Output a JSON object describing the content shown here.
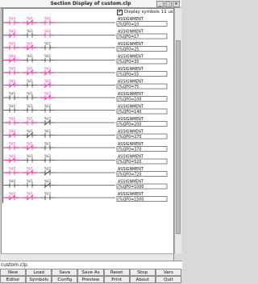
{
  "window": {
    "title": "Section Display of custom.clp"
  },
  "display_symbols": {
    "label": "Display symbols",
    "checked": true,
    "time": "11 us"
  },
  "rungs": [
    {
      "contacts": [
        "%I0",
        "%I1",
        "%I2"
      ],
      "active": [
        true,
        true,
        true
      ],
      "negated": [
        false,
        true,
        false
      ],
      "coil_label": "ASSIGNMENT",
      "coil_value": "(%QF0=10"
    },
    {
      "contacts": [
        "%I0",
        "%I1",
        "%I2"
      ],
      "active": [
        true,
        false,
        true
      ],
      "negated": [
        true,
        false,
        false
      ],
      "coil_label": "ASSIGNMENT",
      "coil_value": "(%QF0=17"
    },
    {
      "contacts": [
        "%I0",
        "%I1",
        "%I2"
      ],
      "active": [
        true,
        true,
        false
      ],
      "negated": [
        false,
        true,
        false
      ],
      "coil_label": "ASSIGNMENT",
      "coil_value": "(%QF0=25"
    },
    {
      "contacts": [
        "%I0",
        "%I1",
        "%I2"
      ],
      "active": [
        true,
        false,
        false
      ],
      "negated": [
        true,
        false,
        false
      ],
      "coil_label": "ASSIGNMENT",
      "coil_value": "(%QF0=35"
    },
    {
      "contacts": [
        "%I0",
        "%I1",
        "%I2"
      ],
      "active": [
        true,
        true,
        true
      ],
      "negated": [
        false,
        true,
        true
      ],
      "coil_label": "ASSIGNMENT",
      "coil_value": "(%QF0=55"
    },
    {
      "contacts": [
        "%I0",
        "%I1",
        "%I2"
      ],
      "active": [
        true,
        false,
        true
      ],
      "negated": [
        true,
        false,
        true
      ],
      "coil_label": "ASSIGNMENT",
      "coil_value": "(%QF0=75"
    },
    {
      "contacts": [
        "%I0",
        "%I1",
        "%I2"
      ],
      "active": [
        false,
        false,
        true
      ],
      "negated": [
        false,
        false,
        true
      ],
      "coil_label": "ASSIGNMENT",
      "coil_value": "(%QF0=100"
    },
    {
      "contacts": [
        "%I0",
        "%I1",
        "%I2"
      ],
      "active": [
        false,
        false,
        false
      ],
      "negated": [
        false,
        false,
        false
      ],
      "coil_label": "ASSIGNMENT",
      "coil_value": "(%QF0=140"
    },
    {
      "contacts": [
        "%I0",
        "%I1",
        "%I2"
      ],
      "active": [
        true,
        true,
        false
      ],
      "negated": [
        false,
        false,
        true
      ],
      "coil_label": "ASSIGNMENT",
      "coil_value": "(%QF0=200"
    },
    {
      "contacts": [
        "%I0",
        "%I1",
        "%I2"
      ],
      "active": [
        true,
        false,
        false
      ],
      "negated": [
        true,
        true,
        false
      ],
      "coil_label": "ASSIGNMENT",
      "coil_value": "(%QF0=270"
    },
    {
      "contacts": [
        "%I0",
        "%I1",
        "%I2"
      ],
      "active": [
        true,
        true,
        false
      ],
      "negated": [
        false,
        true,
        false
      ],
      "coil_label": "ASSIGNMENT",
      "coil_value": "(%QF0=370"
    },
    {
      "contacts": [
        "%I0",
        "%I1",
        "%I2"
      ],
      "active": [
        true,
        false,
        false
      ],
      "negated": [
        true,
        false,
        false
      ],
      "coil_label": "ASSIGNMENT",
      "coil_value": "(%QF0=520"
    },
    {
      "contacts": [
        "%I0",
        "%I1",
        "%I2"
      ],
      "active": [
        true,
        true,
        false
      ],
      "negated": [
        false,
        true,
        true
      ],
      "coil_label": "ASSIGNMENT",
      "coil_value": "(%QF0=720"
    },
    {
      "contacts": [
        "%I0",
        "%I1",
        "%I2"
      ],
      "active": [
        false,
        false,
        false
      ],
      "negated": [
        false,
        false,
        true
      ],
      "coil_label": "ASSIGNMENT",
      "coil_value": "(%QF0=1000"
    },
    {
      "contacts": [
        "%I0",
        "%I1",
        "%I2"
      ],
      "active": [
        true,
        true,
        false
      ],
      "negated": [
        true,
        true,
        false
      ],
      "coil_label": "ASSIGNMENT",
      "coil_value": "(%QF0=1500"
    }
  ],
  "colors": {
    "active": "#ff2fa8",
    "inactive": "#4a4a4a",
    "rail": "#333333"
  },
  "filename": "custom.clp",
  "buttons_row1": [
    "New",
    "Load",
    "Save",
    "Save As",
    "Reset",
    "Stop",
    "Vars"
  ],
  "buttons_row2": [
    "Editor",
    "Symbols",
    "Config",
    "Preview",
    "Print",
    "About",
    "Quit"
  ]
}
